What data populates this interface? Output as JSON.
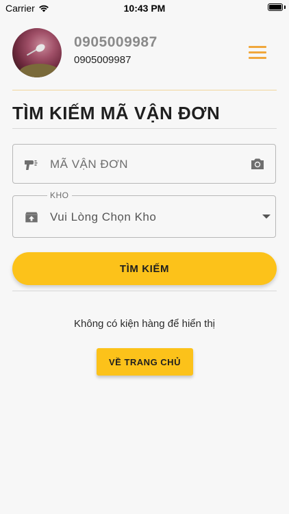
{
  "status_bar": {
    "carrier": "Carrier",
    "time": "10:43 PM",
    "battery_level": 1.0
  },
  "profile": {
    "name": "0905009987",
    "phone": "0905009987"
  },
  "menu": {
    "icon": "hamburger-menu-icon",
    "color": "#f0a73c"
  },
  "page": {
    "title": "TÌM KIẾM MÃ VẬN ĐƠN"
  },
  "tracking_field": {
    "placeholder": "MÃ VẬN ĐƠN",
    "leading_icon": "barcode-scanner-icon",
    "trailing_icon": "camera-icon"
  },
  "warehouse_field": {
    "label": "KHO",
    "selected_value": "Vui Lòng Chọn Kho",
    "leading_icon": "archive-icon",
    "trailing_icon": "dropdown-arrow-icon"
  },
  "actions": {
    "search_label": "TÌM KIẾM",
    "home_label": "VỀ TRANG CHỦ",
    "accent_color": "#fcc21a"
  },
  "results": {
    "empty_message": "Không có kiện hàng để hiển thị"
  }
}
